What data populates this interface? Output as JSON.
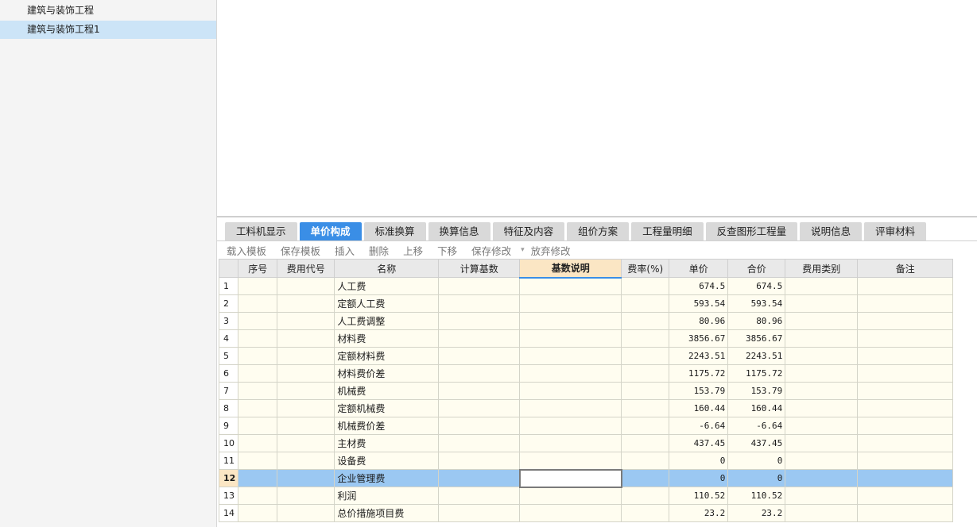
{
  "tree": {
    "items": [
      {
        "label": "建筑与装饰工程",
        "selected": false
      },
      {
        "label": "建筑与装饰工程1",
        "selected": true
      }
    ]
  },
  "tabs": [
    {
      "label": "工料机显示"
    },
    {
      "label": "单价构成",
      "active": true
    },
    {
      "label": "标准换算"
    },
    {
      "label": "换算信息"
    },
    {
      "label": "特征及内容"
    },
    {
      "label": "组价方案"
    },
    {
      "label": "工程量明细"
    },
    {
      "label": "反查图形工程量"
    },
    {
      "label": "说明信息"
    },
    {
      "label": "评审材料"
    }
  ],
  "toolbar": {
    "load_template": "载入模板",
    "save_template": "保存模板",
    "insert": "插入",
    "delete": "删除",
    "move_up": "上移",
    "move_down": "下移",
    "save_changes": "保存修改",
    "discard_changes": "放弃修改"
  },
  "grid": {
    "columns": [
      "",
      "序号",
      "费用代号",
      "名称",
      "计算基数",
      "基数说明",
      "费率(%)",
      "单价",
      "合价",
      "费用类别",
      "备注"
    ],
    "active_column": 5,
    "selected_row": 12,
    "rows": [
      {
        "no": "1",
        "name": "人工费",
        "price": "674.5",
        "total": "674.5"
      },
      {
        "no": "2",
        "name": "定额人工费",
        "price": "593.54",
        "total": "593.54"
      },
      {
        "no": "3",
        "name": "人工费调整",
        "price": "80.96",
        "total": "80.96"
      },
      {
        "no": "4",
        "name": "材料费",
        "price": "3856.67",
        "total": "3856.67"
      },
      {
        "no": "5",
        "name": "定额材料费",
        "price": "2243.51",
        "total": "2243.51"
      },
      {
        "no": "6",
        "name": "材料费价差",
        "price": "1175.72",
        "total": "1175.72"
      },
      {
        "no": "7",
        "name": "机械费",
        "price": "153.79",
        "total": "153.79"
      },
      {
        "no": "8",
        "name": "定额机械费",
        "price": "160.44",
        "total": "160.44"
      },
      {
        "no": "9",
        "name": "机械费价差",
        "price": "-6.64",
        "total": "-6.64"
      },
      {
        "no": "10",
        "name": "主材费",
        "price": "437.45",
        "total": "437.45"
      },
      {
        "no": "11",
        "name": "设备费",
        "price": "0",
        "total": "0"
      },
      {
        "no": "12",
        "name": "企业管理费",
        "price": "0",
        "total": "0"
      },
      {
        "no": "13",
        "name": "利润",
        "price": "110.52",
        "total": "110.52"
      },
      {
        "no": "14",
        "name": "总价措施项目费",
        "price": "23.2",
        "total": "23.2"
      }
    ]
  }
}
